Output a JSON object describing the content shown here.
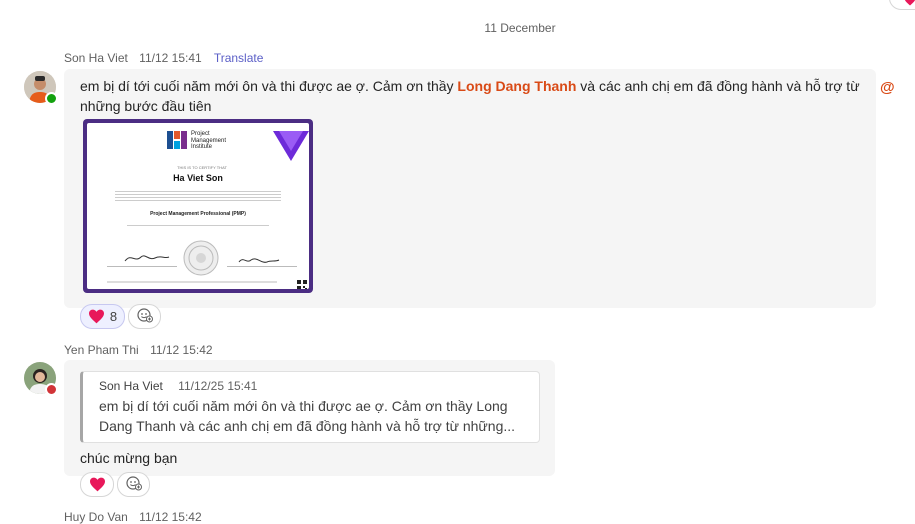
{
  "date_separator": "11 December",
  "messages": [
    {
      "sender": "Son Ha Viet",
      "time": "11/12 15:41",
      "translate_label": "Translate",
      "text_before": "em bị dí tới cuối năm mới ôn và thi được ae ợ. Cảm ơn thầy ",
      "mention": "Long Dang Thanh",
      "text_after": " và các anh chị em đã đồng hành và hỗ trợ từ những bước đầu tiên",
      "reaction_count": "8",
      "status_color": "#13a10e"
    },
    {
      "sender": "Yen Pham Thi",
      "time": "11/12 15:42",
      "quote": {
        "sender": "Son Ha Viet",
        "time": "11/12/25 15:41",
        "text_line1": "em bị dí tới cuối năm mới ôn và thi được ae ợ. Cảm ơn thầy Long",
        "text_line2": "Dang Thanh và các anh chị em đã đồng hành và hỗ trợ từ những..."
      },
      "text": "chúc mừng bạn",
      "status_color": "#d13438"
    },
    {
      "sender": "Huy Do Van",
      "time": "11/12 15:42"
    }
  ],
  "certificate": {
    "org_line1": "Project",
    "org_line2": "Management",
    "org_line3": "Institute",
    "holder": "Ha  Viet Son",
    "credential": "Project Management Professional (PMP)"
  },
  "mention_symbol": "@",
  "colors": {
    "accent": "#5b5fc7",
    "mention": "#d94a16",
    "heart": "#e8185a",
    "certificate_border": "#4b2d83"
  }
}
